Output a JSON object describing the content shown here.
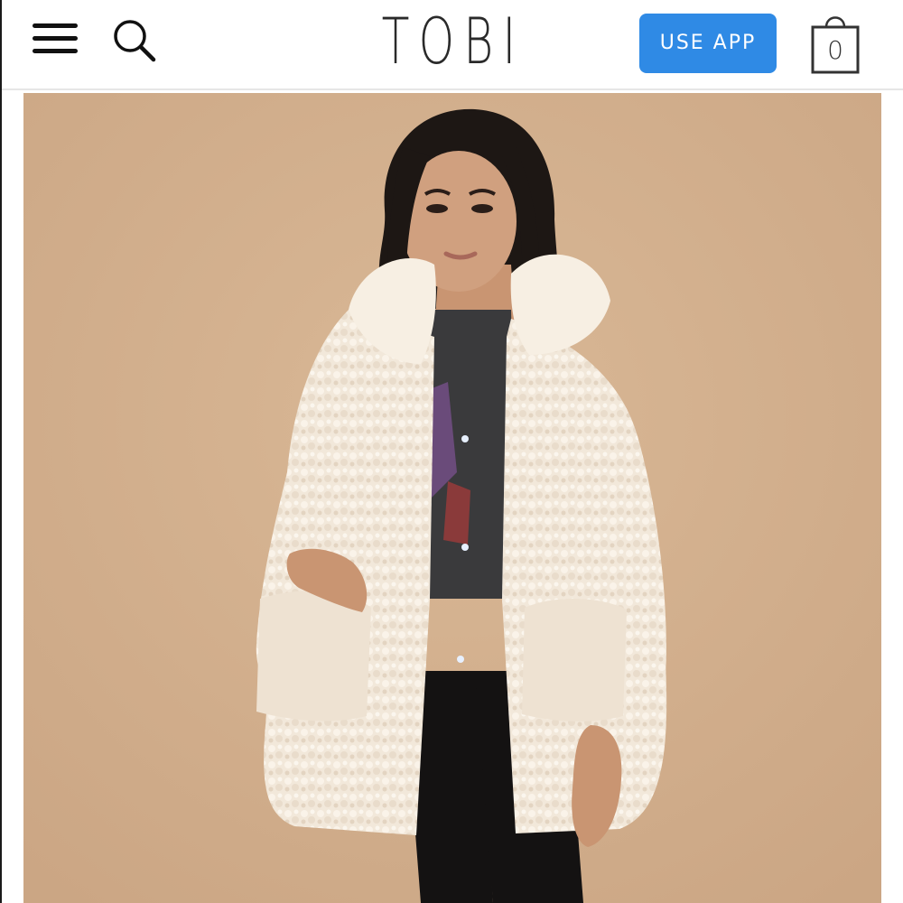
{
  "header": {
    "menu_icon": "hamburger-menu-icon",
    "search_icon": "search-icon",
    "logo_text": "TOBI",
    "use_app_label": "USE APP",
    "cart_icon": "shopping-bag-icon",
    "cart_count": "0"
  },
  "product": {
    "image_subject": "model-wearing-cream-teddy-coat"
  },
  "colors": {
    "accent_button": "#2f8ae5",
    "backdrop": "#d4b18f",
    "coat": "#f3e9dc",
    "hair": "#1d1714"
  }
}
